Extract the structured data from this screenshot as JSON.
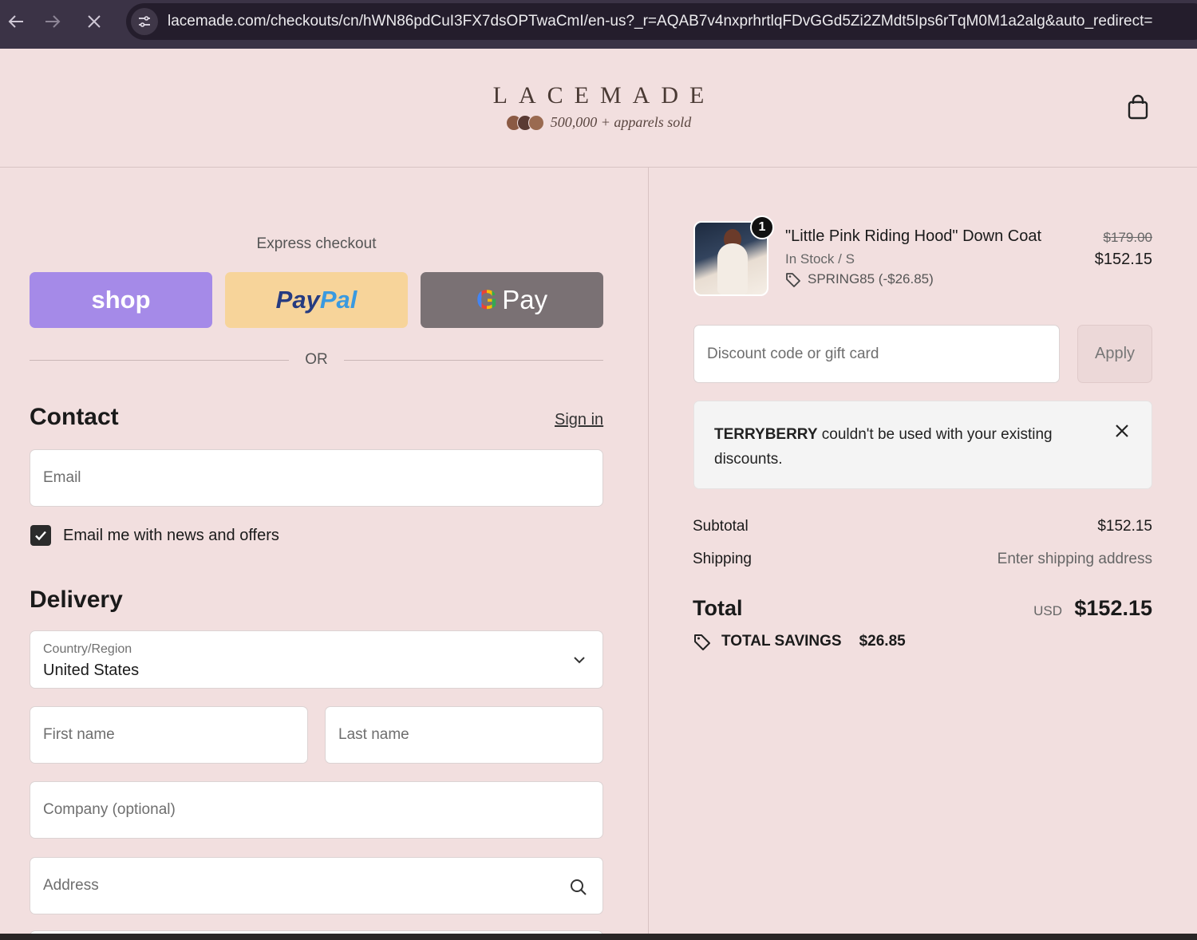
{
  "browser": {
    "url": "lacemade.com/checkouts/cn/hWN86pdCuI3FX7dsOPTwaCmI/en-us?_r=AQAB7v4nxprhrtlqFDvGGd5Zi2ZMdt5Ips6rTqM0M1a2alg&auto_redirect="
  },
  "header": {
    "logo": "LACEMADE",
    "tagline": "500,000 + apparels sold"
  },
  "express": {
    "title": "Express checkout",
    "shop_label": "shop",
    "paypal_label_1": "Pay",
    "paypal_label_2": "Pal",
    "gpay_g": "G",
    "gpay_label": "Pay",
    "or_label": "OR"
  },
  "contact": {
    "heading": "Contact",
    "sign_in": "Sign in",
    "email_placeholder": "Email",
    "newsletter_label": "Email me with news and offers",
    "newsletter_checked": true
  },
  "delivery": {
    "heading": "Delivery",
    "country_label": "Country/Region",
    "country_value": "United States",
    "first_name_placeholder": "First name",
    "last_name_placeholder": "Last name",
    "company_placeholder": "Company (optional)",
    "address_placeholder": "Address"
  },
  "order": {
    "item": {
      "quantity": "1",
      "name": "\"Little Pink Riding Hood\" Down Coat",
      "variant": "In Stock / S",
      "discount": "SPRING85 (-$26.85)",
      "price_original": "$179.00",
      "price": "$152.15"
    },
    "discount_placeholder": "Discount code or gift card",
    "apply_label": "Apply",
    "notice": {
      "code": "TERRYBERRY",
      "message": " couldn't be used with your existing discounts."
    },
    "subtotal_label": "Subtotal",
    "subtotal_value": "$152.15",
    "shipping_label": "Shipping",
    "shipping_value": "Enter shipping address",
    "total_label": "Total",
    "total_currency": "USD",
    "total_value": "$152.15",
    "savings_label": "TOTAL SAVINGS",
    "savings_value": "$26.85"
  },
  "colors": {
    "page_bg": "#f2dfdf",
    "shop_pay": "#a58ae8",
    "paypal": "#f7d49a",
    "gpay": "#7a7174"
  }
}
